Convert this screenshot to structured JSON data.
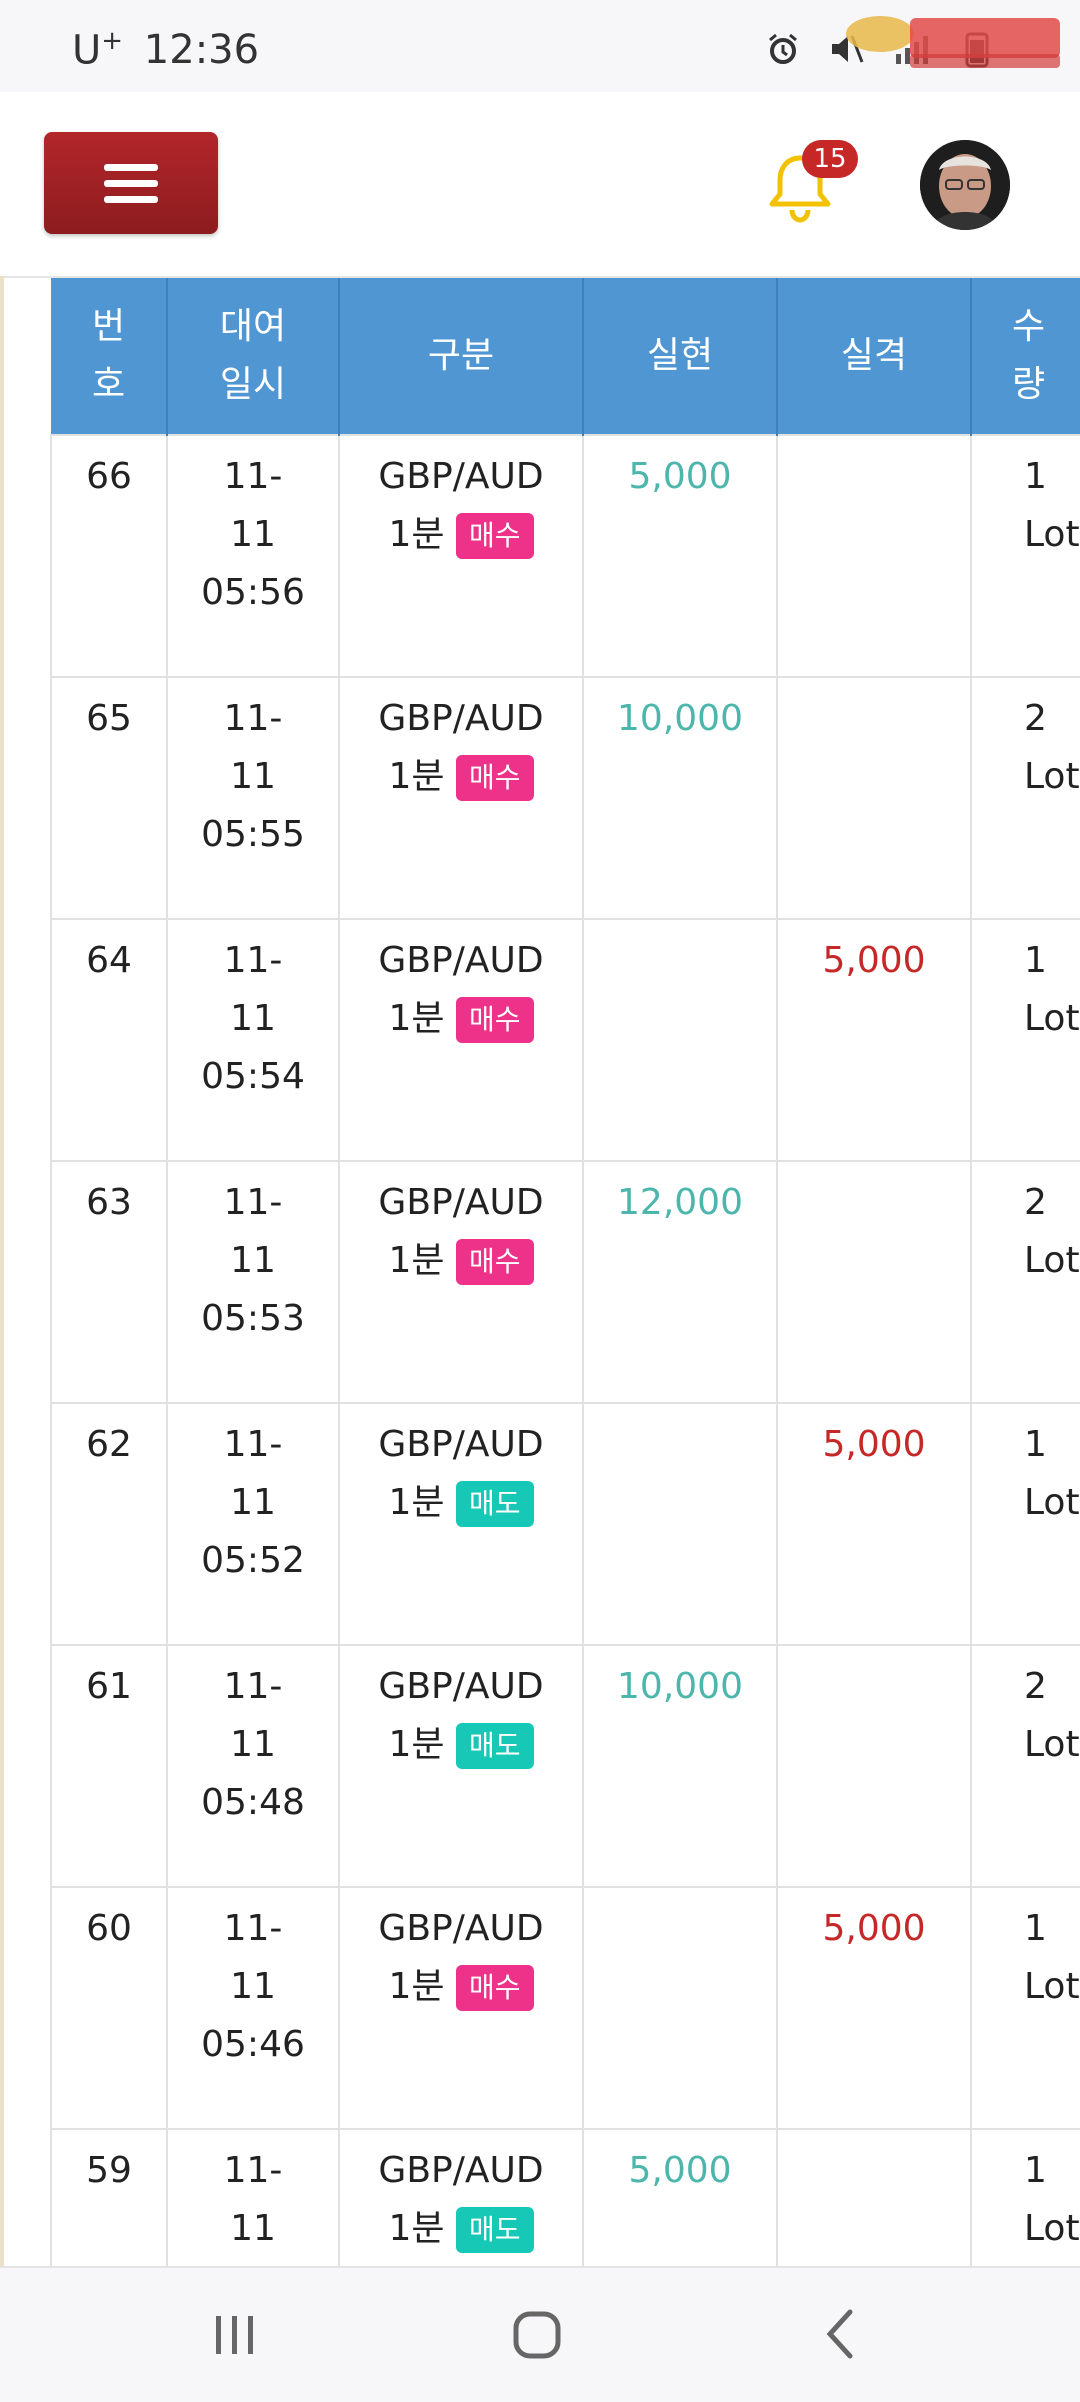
{
  "status_bar": {
    "carrier": "U",
    "carrier_plus": "+",
    "time": "12:36"
  },
  "header": {
    "notification_count": "15"
  },
  "table": {
    "headers": [
      "번\n호",
      "대여\n일시",
      "구분",
      "실현",
      "실격",
      "수\n량"
    ],
    "rows": [
      {
        "no": "66",
        "date": "11-\n11\n05:56",
        "pair": "GBP/AUD",
        "period": "1분",
        "side": "매수",
        "side_type": "buy",
        "gain": "5,000",
        "loss": "",
        "qty": "1\nLot"
      },
      {
        "no": "65",
        "date": "11-\n11\n05:55",
        "pair": "GBP/AUD",
        "period": "1분",
        "side": "매수",
        "side_type": "buy",
        "gain": "10,000",
        "loss": "",
        "qty": "2\nLot"
      },
      {
        "no": "64",
        "date": "11-\n11\n05:54",
        "pair": "GBP/AUD",
        "period": "1분",
        "side": "매수",
        "side_type": "buy",
        "gain": "",
        "loss": "5,000",
        "qty": "1\nLot"
      },
      {
        "no": "63",
        "date": "11-\n11\n05:53",
        "pair": "GBP/AUD",
        "period": "1분",
        "side": "매수",
        "side_type": "buy",
        "gain": "12,000",
        "loss": "",
        "qty": "2\nLot"
      },
      {
        "no": "62",
        "date": "11-\n11\n05:52",
        "pair": "GBP/AUD",
        "period": "1분",
        "side": "매도",
        "side_type": "sell",
        "gain": "",
        "loss": "5,000",
        "qty": "1\nLot"
      },
      {
        "no": "61",
        "date": "11-\n11\n05:48",
        "pair": "GBP/AUD",
        "period": "1분",
        "side": "매도",
        "side_type": "sell",
        "gain": "10,000",
        "loss": "",
        "qty": "2\nLot"
      },
      {
        "no": "60",
        "date": "11-\n11\n05:46",
        "pair": "GBP/AUD",
        "period": "1분",
        "side": "매수",
        "side_type": "buy",
        "gain": "",
        "loss": "5,000",
        "qty": "1\nLot"
      },
      {
        "no": "59",
        "date": "11-\n11",
        "pair": "GBP/AUD",
        "period": "1분",
        "side": "매도",
        "side_type": "sell",
        "gain": "5,000",
        "loss": "",
        "qty": "1\nLot"
      }
    ]
  },
  "colors": {
    "header_bg": "#5096d2",
    "menu_button": "#a12226",
    "gain": "#4db6ac",
    "loss": "#c62828",
    "buy_badge": "#ef3289",
    "sell_badge": "#18c8b6",
    "bell": "#f2c200",
    "badge_bg": "#c62828"
  },
  "icons": {
    "menu": "hamburger-icon",
    "notifications": "bell-icon",
    "nav_recent": "recent-apps-icon",
    "nav_home": "home-icon",
    "nav_back": "back-icon"
  }
}
